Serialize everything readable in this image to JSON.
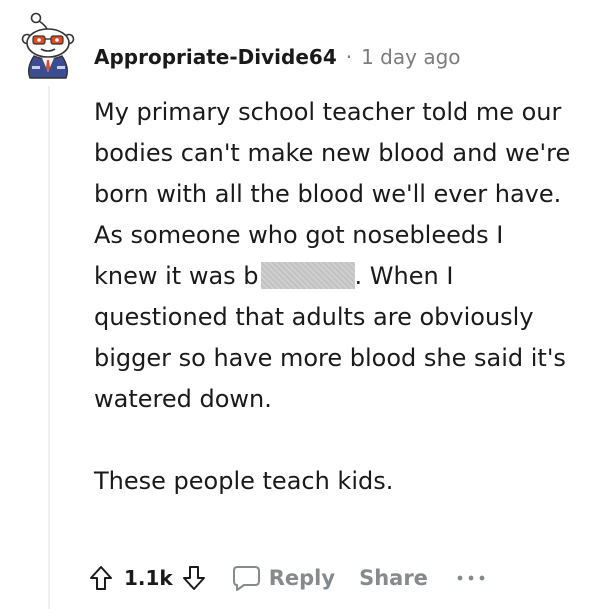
{
  "comment": {
    "username": "Appropriate-Divide64",
    "separator": "·",
    "timestamp": "1 day ago",
    "body": {
      "paragraph1_start": "My primary school teacher told me our bodies can't make new blood and we're born with all the blood we'll ever have. As someone who got nosebleeds I knew it was b",
      "paragraph1_end": ". When I questioned that adults are obviously bigger so have more blood she said it's watered down.",
      "paragraph2": "These people teach kids."
    },
    "actions": {
      "vote_count": "1.1k",
      "reply_label": "Reply",
      "share_label": "Share"
    }
  },
  "icons": {
    "upvote": "arrow-up-icon",
    "downvote": "arrow-down-icon",
    "reply": "speech-bubble-icon",
    "more": "ellipsis-icon"
  },
  "colors": {
    "text_primary": "#1a1a1b",
    "text_muted": "#878a8c",
    "thread_line": "#edeff1",
    "avatar_tie": "#e24a1f"
  }
}
